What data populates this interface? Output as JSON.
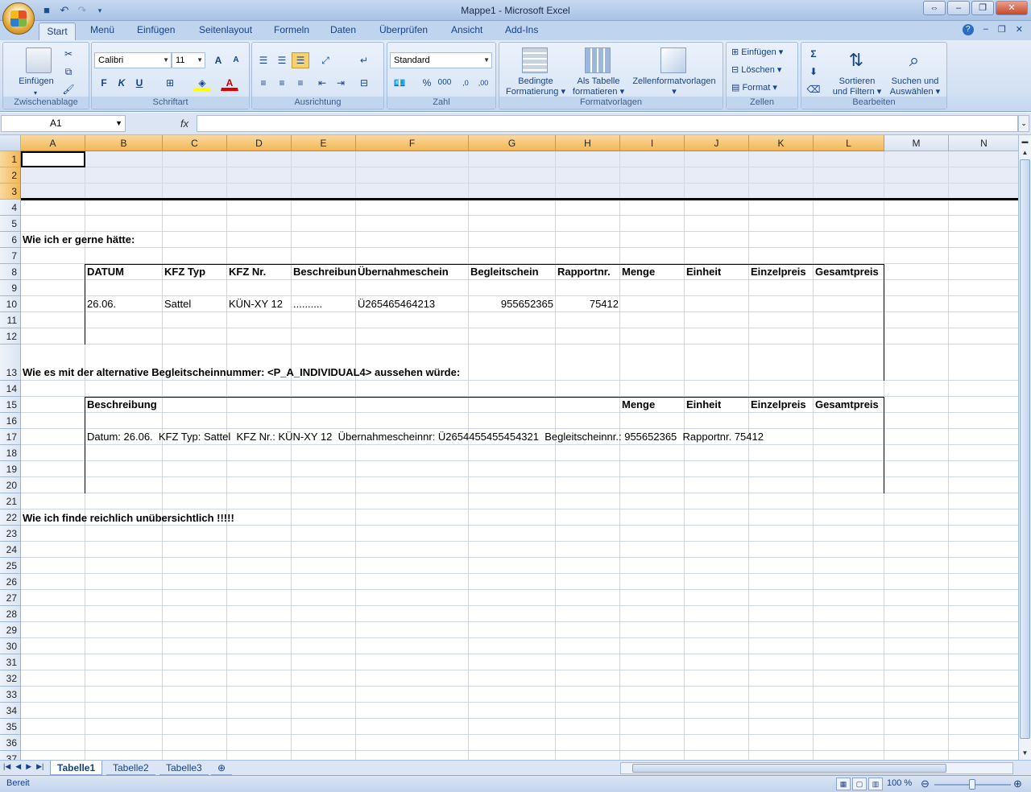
{
  "window": {
    "title": "Mappe1 - Microsoft Excel"
  },
  "qat": {
    "save_icon": "save-icon",
    "undo_icon": "undo-icon",
    "redo_icon": "redo-icon"
  },
  "tabs": [
    "Start",
    "Menü",
    "Einfügen",
    "Seitenlayout",
    "Formeln",
    "Daten",
    "Überprüfen",
    "Ansicht",
    "Add-Ins"
  ],
  "ribbon": {
    "clipboard": {
      "paste": "Einfügen",
      "label": "Zwischenablage"
    },
    "font": {
      "name": "Calibri",
      "size": "11",
      "bold": "F",
      "italic": "K",
      "underline": "U",
      "label": "Schriftart"
    },
    "alignment": {
      "label": "Ausrichtung"
    },
    "number": {
      "format": "Standard",
      "percent": "%",
      "thousands": "000",
      "label": "Zahl"
    },
    "styles": {
      "conditional_1": "Bedingte",
      "conditional_2": "Formatierung",
      "table_1": "Als Tabelle",
      "table_2": "formatieren",
      "cell_styles": "Zellenformatvorlagen",
      "label": "Formatvorlagen"
    },
    "cells": {
      "insert": "Einfügen",
      "delete": "Löschen",
      "format": "Format",
      "label": "Zellen"
    },
    "editing": {
      "sort_1": "Sortieren",
      "sort_2": "und Filtern",
      "find_1": "Suchen und",
      "find_2": "Auswählen",
      "label": "Bearbeiten"
    }
  },
  "formula_bar": {
    "name_box": "A1",
    "fx": "fx",
    "formula": ""
  },
  "columns": [
    "A",
    "B",
    "C",
    "D",
    "E",
    "F",
    "G",
    "H",
    "I",
    "J",
    "K",
    "L",
    "M",
    "N"
  ],
  "rows": [
    "1",
    "2",
    "3",
    "4",
    "5",
    "6",
    "7",
    "8",
    "9",
    "10",
    "11",
    "12",
    "13",
    "14",
    "15",
    "16",
    "17",
    "18",
    "19",
    "20",
    "21",
    "22",
    "23",
    "24",
    "25",
    "26",
    "27",
    "28",
    "29",
    "30",
    "31",
    "32",
    "33",
    "34",
    "35",
    "36",
    "37"
  ],
  "sheet": {
    "heading1": "Wie ich er gerne hätte:",
    "table1_headers": [
      "DATUM",
      "KFZ Typ",
      "KFZ Nr.",
      "Beschreibun",
      "Übernahmeschein",
      "Begleitschein",
      "Rapportnr.",
      "Menge",
      "Einheit",
      "Einzelpreis",
      "Gesamtpreis"
    ],
    "table1_row": {
      "datum": "26.06.",
      "kfz_typ": "Sattel",
      "kfz_nr": "KÜN-XY 12",
      "beschreibung": "..........",
      "uebernahmeschein": "Ü265465464213",
      "begleitschein": "955652365",
      "rapportnr": "75412"
    },
    "heading2": "Wie es mit der alternative Begleitscheinnummer: <P_A_INDIVIDUAL4> aussehen würde:",
    "table2_headers": {
      "beschreibung": "Beschreibung",
      "menge": "Menge",
      "einheit": "Einheit",
      "einzelpreis": "Einzelpreis",
      "gesamtpreis": "Gesamtpreis"
    },
    "table2_row": "Datum: 26.06.  KFZ Typ: Sattel  KFZ Nr.: KÜN-XY 12  Übernahmescheinnr: Ü2654455455454321  Begleitscheinnr.: 955652365  Rapportnr. 75412",
    "heading3": "Wie ich finde reichlich unübersichtlich !!!!!"
  },
  "sheet_tabs": [
    "Tabelle1",
    "Tabelle2",
    "Tabelle3"
  ],
  "status": {
    "text": "Bereit",
    "zoom": "100 %"
  }
}
